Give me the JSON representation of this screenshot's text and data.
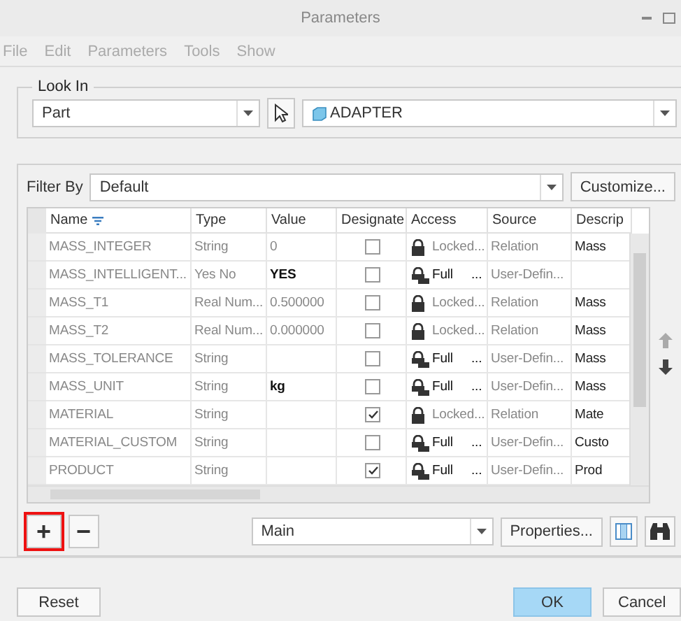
{
  "window": {
    "title": "Parameters"
  },
  "menu": [
    "File",
    "Edit",
    "Parameters",
    "Tools",
    "Show"
  ],
  "look_in": {
    "legend": "Look In",
    "type_value": "Part",
    "object_value": "ADAPTER"
  },
  "filter": {
    "label": "Filter By",
    "value": "Default",
    "customize": "Customize..."
  },
  "table": {
    "columns": [
      {
        "label": "Name",
        "filter": true
      },
      {
        "label": "Type"
      },
      {
        "label": "Value"
      },
      {
        "label": "Designate"
      },
      {
        "label": "Access"
      },
      {
        "label": "Source"
      },
      {
        "label": "Descrip"
      }
    ],
    "rows": [
      {
        "name": "MASS_INTEGER",
        "type": "String",
        "value": "0",
        "value_editable": false,
        "designate": false,
        "access": {
          "kind": "locked",
          "label": "Locked..."
        },
        "source": "Relation",
        "description": "Mass"
      },
      {
        "name": "MASS_INTELLIGENT...",
        "type": "Yes No",
        "value": "YES",
        "value_editable": true,
        "designate": false,
        "access": {
          "kind": "full",
          "label": "Full",
          "more": "..."
        },
        "source": "User-Defin...",
        "description": ""
      },
      {
        "name": "MASS_T1",
        "type": "Real Num...",
        "value": "0.500000",
        "value_editable": false,
        "designate": false,
        "access": {
          "kind": "locked",
          "label": "Locked..."
        },
        "source": "Relation",
        "description": "Mass"
      },
      {
        "name": "MASS_T2",
        "type": "Real Num...",
        "value": "0.000000",
        "value_editable": false,
        "designate": false,
        "access": {
          "kind": "locked",
          "label": "Locked..."
        },
        "source": "Relation",
        "description": "Mass"
      },
      {
        "name": "MASS_TOLERANCE",
        "type": "String",
        "value": "",
        "designate": false,
        "access": {
          "kind": "full",
          "label": "Full",
          "more": "..."
        },
        "source": "User-Defin...",
        "description": "Mass"
      },
      {
        "name": "MASS_UNIT",
        "type": "String",
        "value": "kg",
        "value_editable": true,
        "designate": false,
        "access": {
          "kind": "full",
          "label": "Full",
          "more": "..."
        },
        "source": "User-Defin...",
        "description": "Mass"
      },
      {
        "name": "MATERIAL",
        "type": "String",
        "value": "",
        "designate": true,
        "access": {
          "kind": "locked",
          "label": "Locked..."
        },
        "source": "Relation",
        "description": "Mate"
      },
      {
        "name": "MATERIAL_CUSTOM",
        "type": "String",
        "value": "",
        "designate": false,
        "access": {
          "kind": "full",
          "label": "Full",
          "more": "..."
        },
        "source": "User-Defin...",
        "description": "Custo"
      },
      {
        "name": "PRODUCT",
        "type": "String",
        "value": "",
        "designate": true,
        "access": {
          "kind": "full",
          "label": "Full",
          "more": "..."
        },
        "source": "User-Defin...",
        "description": "Prod"
      }
    ]
  },
  "toolbar": {
    "add": {
      "label": "+",
      "highlighted": true
    },
    "remove": {
      "label": "−",
      "highlighted": false
    },
    "view": "Main",
    "properties": "Properties..."
  },
  "buttons": [
    {
      "label": "Reset",
      "primary": false
    },
    {
      "label": "OK",
      "primary": true
    },
    {
      "label": "Cancel",
      "primary": false
    }
  ]
}
